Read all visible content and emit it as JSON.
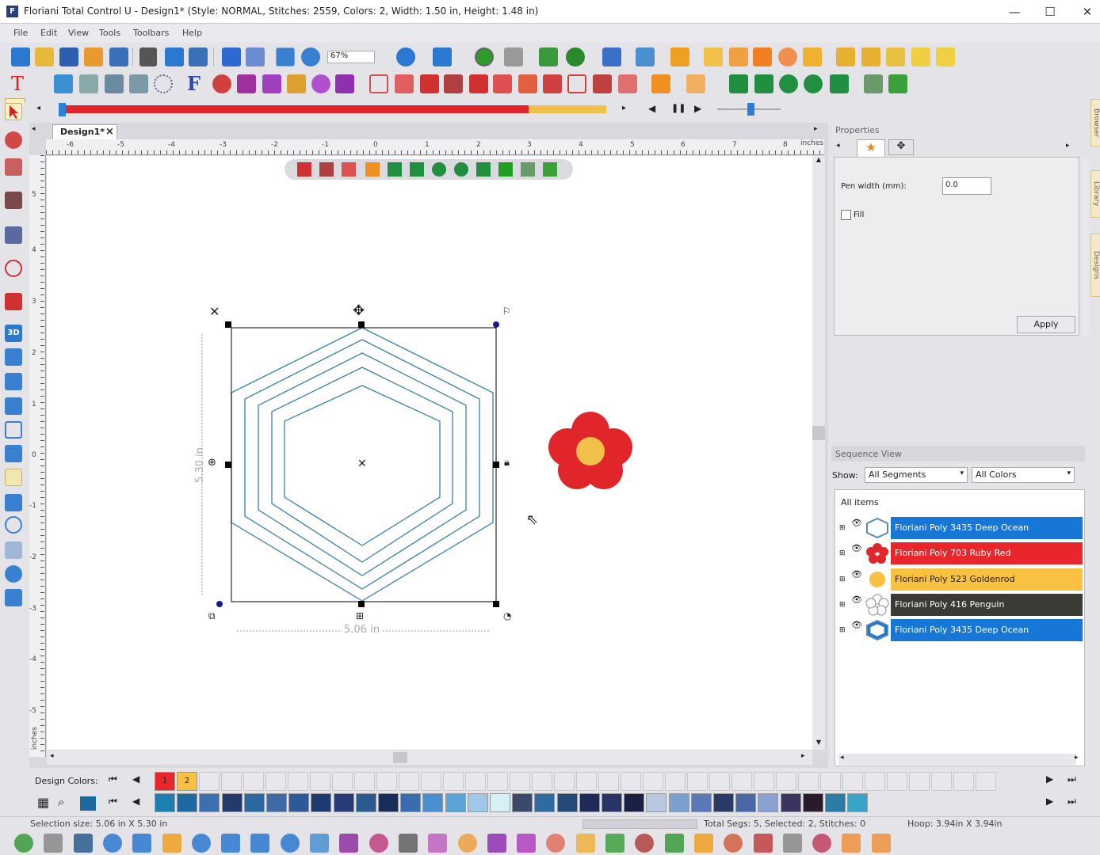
{
  "window": {
    "title": "Floriani Total Control U - Design1* (Style: NORMAL, Stitches: 2559, Colors: 2, Width: 1.50 in, Height: 1.48 in)",
    "minimize": "—",
    "maximize": "☐",
    "close": "✕"
  },
  "menu": [
    "File",
    "Edit",
    "View",
    "Tools",
    "Toolbars",
    "Help"
  ],
  "toolbar": {
    "zoom_value": "67%"
  },
  "document": {
    "tab_label": "Design1*",
    "tab_close": "×"
  },
  "ruler": {
    "units": "inches",
    "top_ticks": [
      "-6",
      "-5",
      "-4",
      "-3",
      "-2",
      "-1",
      "0",
      "1",
      "2",
      "3",
      "4",
      "5",
      "6",
      "7",
      "8"
    ],
    "left_ticks": [
      "5",
      "4",
      "3",
      "2",
      "1",
      "0",
      "-1",
      "-2",
      "-3",
      "-4",
      "-5"
    ],
    "left_units": "inches"
  },
  "canvas": {
    "height_dim": "5.30 in",
    "width_dim": "5.06 in"
  },
  "properties": {
    "title": "Properties",
    "pen_width_label": "Pen width (mm):",
    "pen_width_value": "0.0",
    "fill_label": "Fill",
    "apply_label": "Apply"
  },
  "sequence": {
    "title": "Sequence View",
    "show_label": "Show:",
    "segments_filter": "All Segments",
    "colors_filter": "All Colors",
    "root_label": "All items",
    "items": [
      {
        "label": "Floriani Poly 3435 Deep Ocean",
        "color": "#1677d6",
        "text": "#fff",
        "icon": "hexagon-outline-icon"
      },
      {
        "label": "Floriani Poly 703 Ruby Red",
        "color": "#e8262b",
        "text": "#fff",
        "icon": "flower-icon"
      },
      {
        "label": "Floriani Poly 523 Goldenrod",
        "color": "#f8c240",
        "text": "#222",
        "icon": "circle-icon"
      },
      {
        "label": "Floriani Poly 416 Penguin",
        "color": "#3b3a34",
        "text": "#fff",
        "icon": "flower-outline-icon"
      },
      {
        "label": "Floriani Poly 3435 Deep Ocean",
        "color": "#1677d6",
        "text": "#fff",
        "icon": "hexagon-icon"
      }
    ]
  },
  "side_tabs": [
    "Browser",
    "Library",
    "Designs"
  ],
  "design_colors": {
    "label": "Design Colors:",
    "swatches": [
      {
        "num": "1",
        "color": "#e8262b"
      },
      {
        "num": "2",
        "color": "#f8c240"
      }
    ],
    "palette": [
      "#1c7fb0",
      "#1e6aa0",
      "#3b6fb0",
      "#243a6a",
      "#2b6aa0",
      "#3f6aa5",
      "#2d5a96",
      "#1e3a6e",
      "#283a78",
      "#2b5a90",
      "#1a2c5a",
      "#3b6cb0",
      "#4a90d0",
      "#5aa4da",
      "#9fc8e8",
      "#d6f0f8",
      "#3a4a6a",
      "#2f6aa0",
      "#234a78",
      "#1e2a5a",
      "#2a3366",
      "#1a1f44",
      "#b8c8e0",
      "#7aa0d0",
      "#5a78b8",
      "#2a3a66",
      "#4a68a8",
      "#8aa0d0",
      "#3a3560",
      "#2a1a2e",
      "#2b7aa8",
      "#3aa4c8"
    ]
  },
  "status": {
    "selection": "Selection size: 5.06 in X 5.30 in",
    "total": "Total Segs: 5, Selected: 2, Stitches: 0",
    "hoop": "Hoop: 3.94in X 3.94in"
  }
}
